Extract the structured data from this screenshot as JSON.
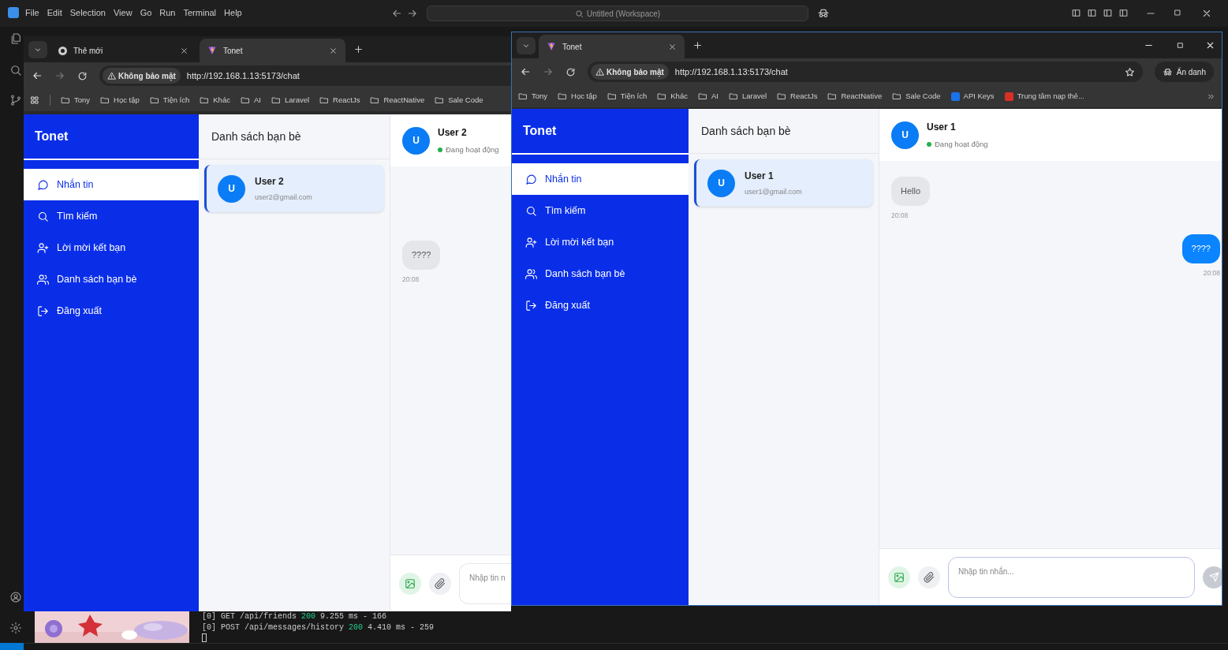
{
  "editor": {
    "menu": [
      "File",
      "Edit",
      "Selection",
      "View",
      "Go",
      "Run",
      "Terminal",
      "Help"
    ],
    "search_title": "Untitled (Workspace)",
    "terminal_lines": [
      {
        "prefix": "[0] GET /api/friends",
        "code": "200",
        "suffix": "9.255 ms - 166"
      },
      {
        "prefix": "[0] POST /api/messages/history",
        "code": "200",
        "suffix": "4.410 ms - 259"
      }
    ]
  },
  "browsers": [
    {
      "incognito": false,
      "tabs": [
        {
          "label": "Thẻ mới",
          "kind": "newtab",
          "selected": false
        },
        {
          "label": "Tonet",
          "kind": "site",
          "selected": true
        }
      ],
      "security_label": "Không bảo mật",
      "url": "http://192.168.1.13:5173/chat",
      "bookmarks": [
        {
          "label": "Tony",
          "kind": "folder"
        },
        {
          "label": "Học tập",
          "kind": "folder"
        },
        {
          "label": "Tiện ích",
          "kind": "folder"
        },
        {
          "label": "Khác",
          "kind": "folder"
        },
        {
          "label": "AI",
          "kind": "folder"
        },
        {
          "label": "Laravel",
          "kind": "folder"
        },
        {
          "label": "ReactJs",
          "kind": "folder"
        },
        {
          "label": "ReactNative",
          "kind": "folder"
        },
        {
          "label": "Sale Code",
          "kind": "folder"
        }
      ],
      "app": {
        "brand": "Tonet",
        "nav": [
          {
            "label": "Nhắn tin",
            "kind": "chat",
            "selected": true
          },
          {
            "label": "Tìm kiếm",
            "kind": "search",
            "selected": false
          },
          {
            "label": "Lời mời kết bạn",
            "kind": "invite",
            "selected": false
          },
          {
            "label": "Danh sách bạn bè",
            "kind": "friends",
            "selected": false
          },
          {
            "label": "Đăng xuất",
            "kind": "logout",
            "selected": false
          }
        ],
        "friends_title": "Danh sách bạn bè",
        "friends": [
          {
            "avatar": "U",
            "name": "User 2",
            "email": "user2@gmail.com",
            "selected": true
          }
        ],
        "chat": {
          "avatar": "U",
          "name": "User 2",
          "status": "Đang hoạt động",
          "messages": [
            {
              "text": "????",
              "time": "20:08",
              "mine": false
            }
          ],
          "placeholder": "Nhập tin n",
          "send_button": false
        }
      }
    },
    {
      "incognito": true,
      "incognito_label": "Ẩn danh",
      "tabs": [
        {
          "label": "Tonet",
          "kind": "site",
          "selected": true
        }
      ],
      "security_label": "Không bảo mật",
      "url": "http://192.168.1.13:5173/chat",
      "bookmarks": [
        {
          "label": "Tony",
          "kind": "folder"
        },
        {
          "label": "Học tập",
          "kind": "folder"
        },
        {
          "label": "Tiện ích",
          "kind": "folder"
        },
        {
          "label": "Khác",
          "kind": "folder"
        },
        {
          "label": "AI",
          "kind": "folder"
        },
        {
          "label": "Laravel",
          "kind": "folder"
        },
        {
          "label": "ReactJs",
          "kind": "folder"
        },
        {
          "label": "ReactNative",
          "kind": "folder"
        },
        {
          "label": "Sale Code",
          "kind": "folder"
        },
        {
          "label": "API Keys",
          "kind": "site",
          "color": "#1a73e8"
        },
        {
          "label": "Trung tâm nạp thẻ...",
          "kind": "site",
          "color": "#d93025"
        }
      ],
      "app": {
        "brand": "Tonet",
        "nav": [
          {
            "label": "Nhắn tin",
            "kind": "chat",
            "selected": true
          },
          {
            "label": "Tìm kiếm",
            "kind": "search",
            "selected": false
          },
          {
            "label": "Lời mời kết bạn",
            "kind": "invite",
            "selected": false
          },
          {
            "label": "Danh sách bạn bè",
            "kind": "friends",
            "selected": false
          },
          {
            "label": "Đăng xuất",
            "kind": "logout",
            "selected": false
          }
        ],
        "friends_title": "Danh sách bạn bè",
        "friends": [
          {
            "avatar": "U",
            "name": "User 1",
            "email": "user1@gmail.com",
            "selected": true
          }
        ],
        "chat": {
          "avatar": "U",
          "name": "User 1",
          "status": "Đang hoạt động",
          "messages": [
            {
              "text": "Hello",
              "time": "20:08",
              "mine": false
            },
            {
              "text": "????",
              "time": "20:08",
              "mine": true
            }
          ],
          "placeholder": "Nhập tin nhắn...",
          "send_button": true
        }
      }
    }
  ]
}
